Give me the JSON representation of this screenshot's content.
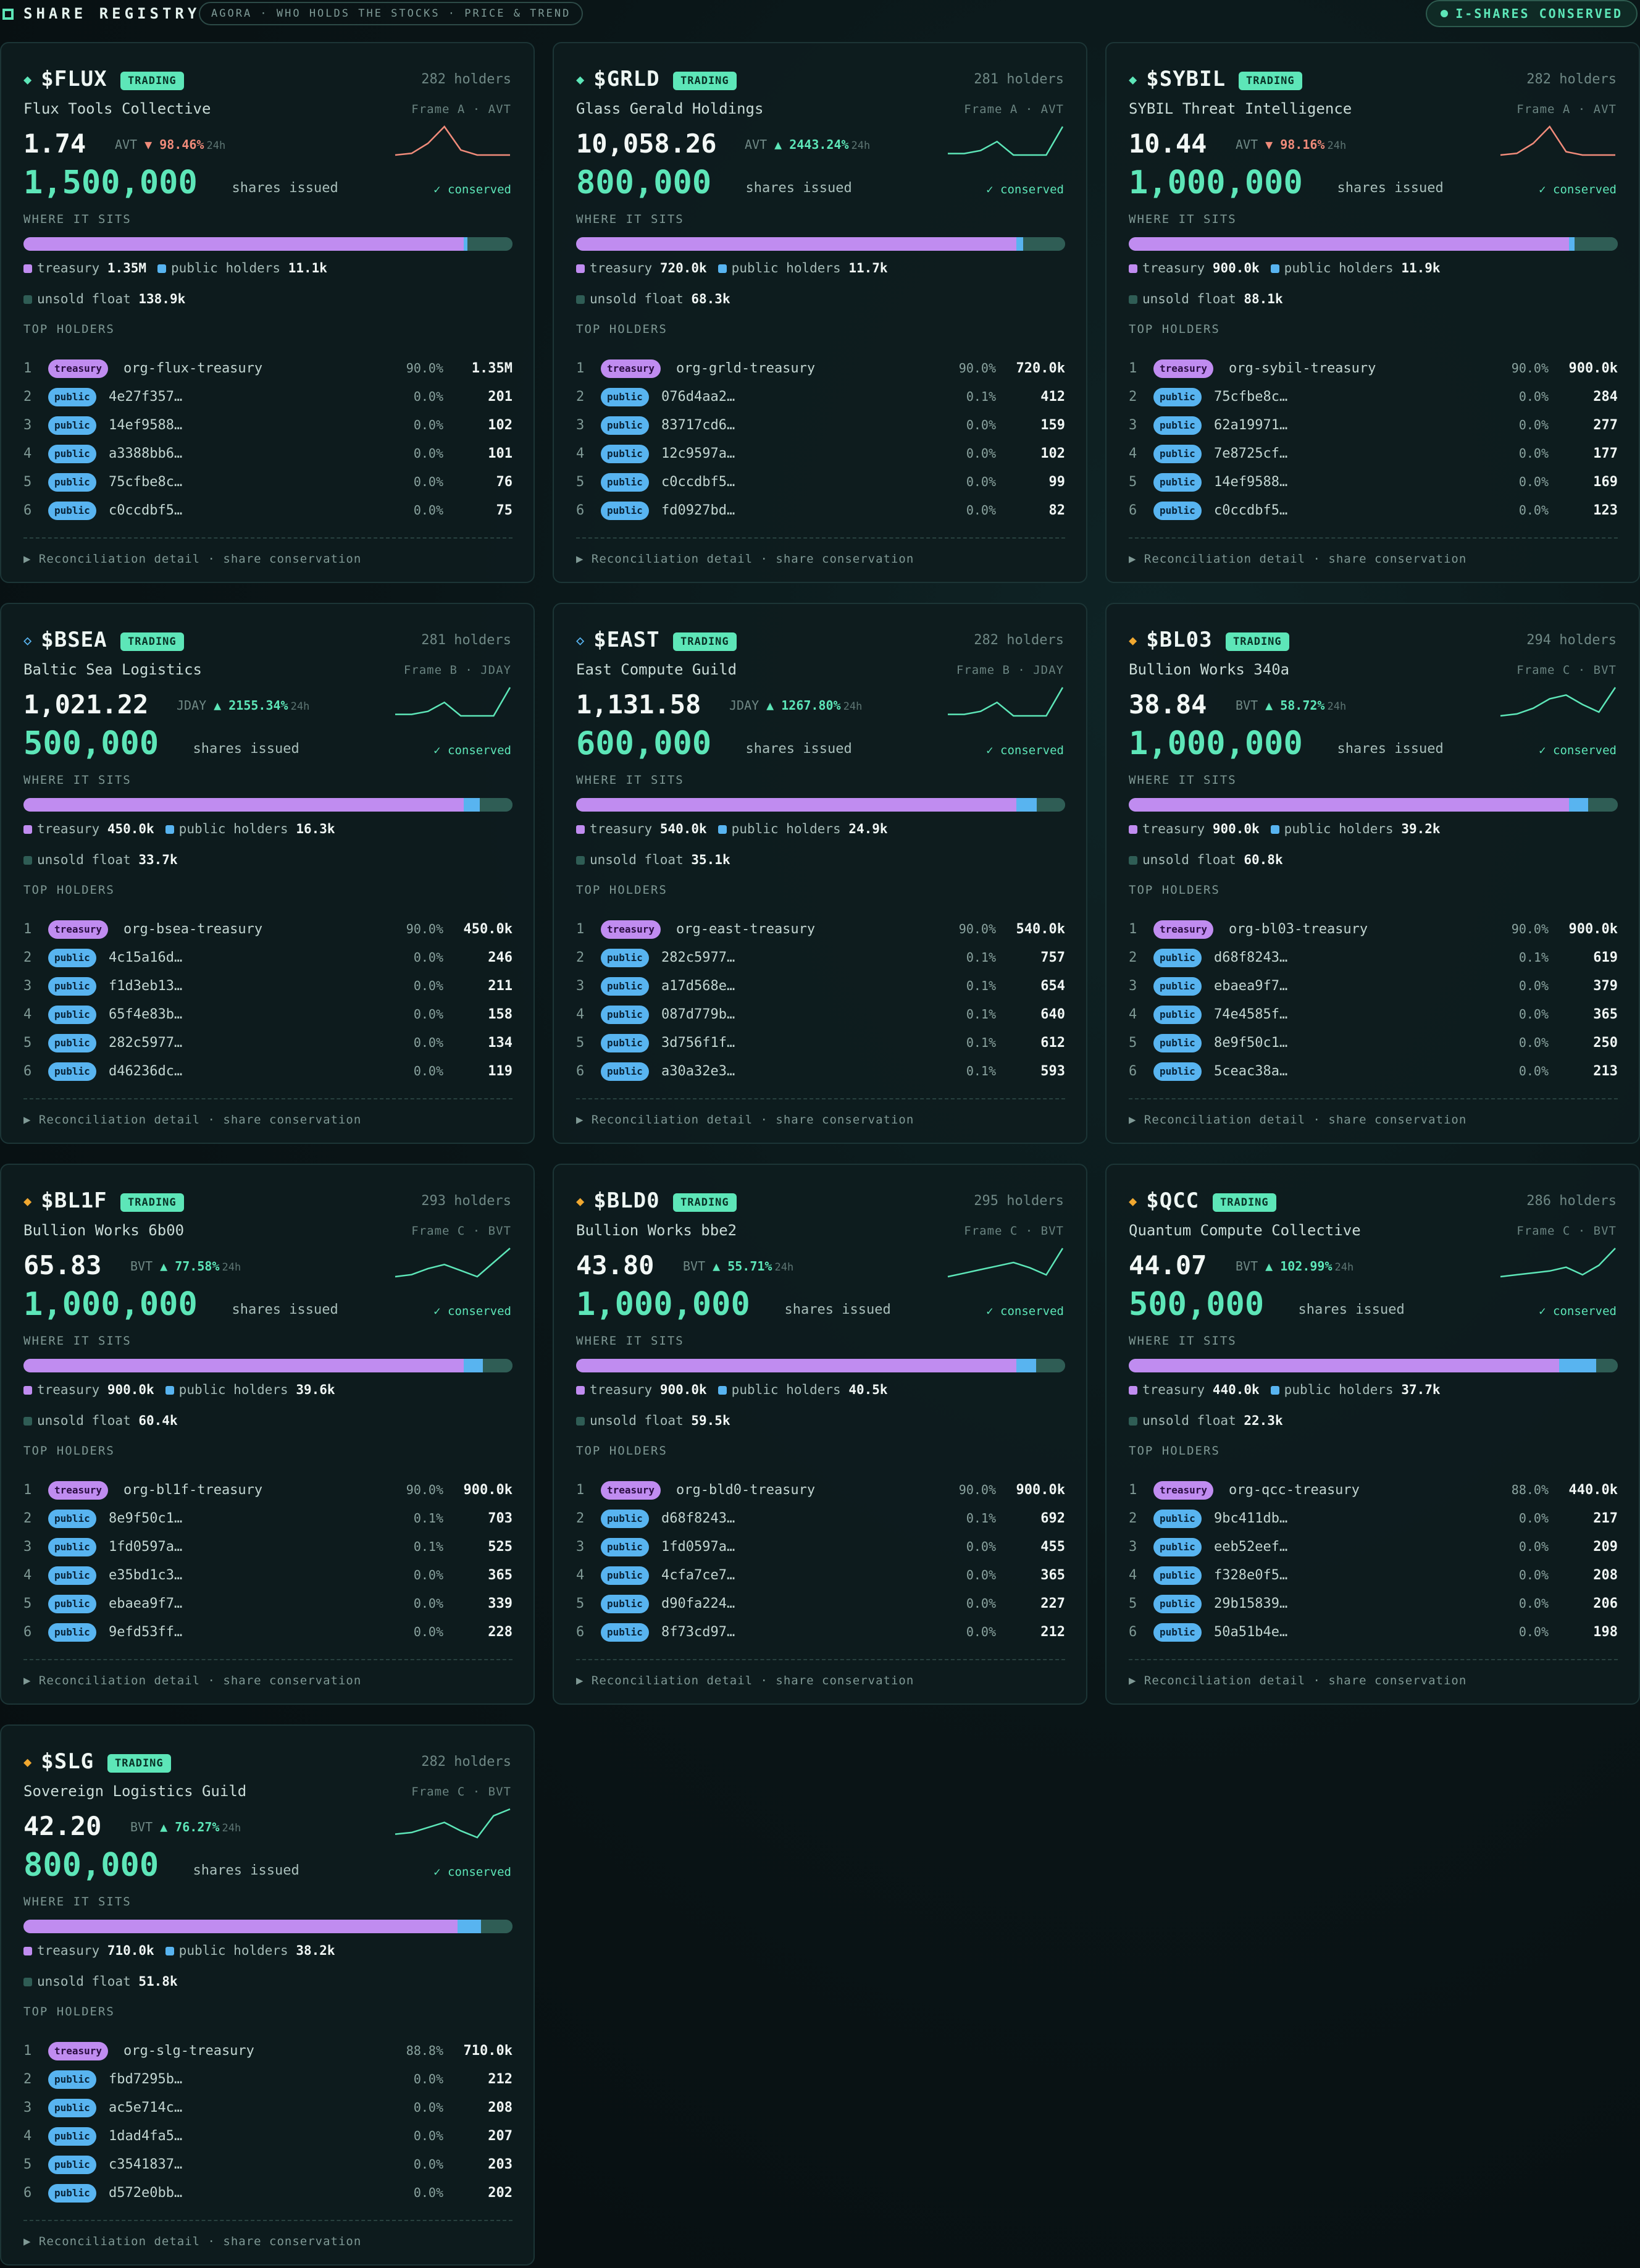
{
  "app": {
    "title": "SHARE REGISTRY",
    "subtitle": "AGORA · WHO HOLDS THE STOCKS · PRICE & TREND",
    "status": "I-SHARES CONSERVED"
  },
  "labels": {
    "trading": "TRADING",
    "shares_issued": "shares issued",
    "conserved": "✓ conserved",
    "where_it_sits": "WHERE IT SITS",
    "treasury": "treasury",
    "public_holders": "public holders",
    "unsold_float": "unsold float",
    "top_holders": "TOP HOLDERS",
    "reconciliation": "▶ Reconciliation detail · share conservation",
    "h24": "24h"
  },
  "colors": {
    "accent": "#5de6b8",
    "treasury": "#c08cf0",
    "public": "#58b4f0",
    "float": "#2f5d55",
    "down": "#f08b7a",
    "frameA": "#5de6b8",
    "frameB": "#58b4f0",
    "frameC": "#f0a830"
  },
  "cards": [
    {
      "ticker": "$FLUX",
      "icon": "diamond-icon",
      "icon_color": "#5de6b8",
      "holders": "282 holders",
      "company": "Flux Tools Collective",
      "frame": "Frame A · AVT",
      "price": "1.74",
      "unit": "AVT",
      "arrow": "▼",
      "change": "98.46%",
      "direction": "down",
      "spark": [
        5,
        6,
        12,
        22,
        8,
        5,
        5,
        5
      ],
      "issued": "1,500,000",
      "treasury_frac": 0.9,
      "public_frac": 0.0074,
      "float_frac": 0.0926,
      "treasury": "1.35M",
      "public": "11.1k",
      "float": "138.9k",
      "top": [
        {
          "n": "1",
          "type": "treasury",
          "name": "org-flux-treasury",
          "pct": "90.0%",
          "amt": "1.35M"
        },
        {
          "n": "2",
          "type": "public",
          "name": "4e27f357…",
          "pct": "0.0%",
          "amt": "201"
        },
        {
          "n": "3",
          "type": "public",
          "name": "14ef9588…",
          "pct": "0.0%",
          "amt": "102"
        },
        {
          "n": "4",
          "type": "public",
          "name": "a3388bb6…",
          "pct": "0.0%",
          "amt": "101"
        },
        {
          "n": "5",
          "type": "public",
          "name": "75cfbe8c…",
          "pct": "0.0%",
          "amt": "76"
        },
        {
          "n": "6",
          "type": "public",
          "name": "c0ccdbf5…",
          "pct": "0.0%",
          "amt": "75"
        }
      ]
    },
    {
      "ticker": "$GRLD",
      "icon": "diamond-icon",
      "icon_color": "#5de6b8",
      "holders": "281 holders",
      "company": "Glass Gerald Holdings",
      "frame": "Frame A · AVT",
      "price": "10,058.26",
      "unit": "AVT",
      "arrow": "▲",
      "change": "2443.24%",
      "direction": "up",
      "spark": [
        4,
        4,
        6,
        12,
        3,
        3,
        3,
        22
      ],
      "issued": "800,000",
      "treasury_frac": 0.9,
      "public_frac": 0.0146,
      "float_frac": 0.0854,
      "treasury": "720.0k",
      "public": "11.7k",
      "float": "68.3k",
      "top": [
        {
          "n": "1",
          "type": "treasury",
          "name": "org-grld-treasury",
          "pct": "90.0%",
          "amt": "720.0k"
        },
        {
          "n": "2",
          "type": "public",
          "name": "076d4aa2…",
          "pct": "0.1%",
          "amt": "412"
        },
        {
          "n": "3",
          "type": "public",
          "name": "83717cd6…",
          "pct": "0.0%",
          "amt": "159"
        },
        {
          "n": "4",
          "type": "public",
          "name": "12c9597a…",
          "pct": "0.0%",
          "amt": "102"
        },
        {
          "n": "5",
          "type": "public",
          "name": "c0ccdbf5…",
          "pct": "0.0%",
          "amt": "99"
        },
        {
          "n": "6",
          "type": "public",
          "name": "fd0927bd…",
          "pct": "0.0%",
          "amt": "82"
        }
      ]
    },
    {
      "ticker": "$SYBIL",
      "icon": "diamond-icon",
      "icon_color": "#5de6b8",
      "holders": "282 holders",
      "company": "SYBIL Threat Intelligence",
      "frame": "Frame A · AVT",
      "price": "10.44",
      "unit": "AVT",
      "arrow": "▼",
      "change": "98.16%",
      "direction": "down",
      "spark": [
        5,
        6,
        12,
        22,
        7,
        5,
        5,
        5
      ],
      "issued": "1,000,000",
      "treasury_frac": 0.9,
      "public_frac": 0.0119,
      "float_frac": 0.0881,
      "treasury": "900.0k",
      "public": "11.9k",
      "float": "88.1k",
      "top": [
        {
          "n": "1",
          "type": "treasury",
          "name": "org-sybil-treasury",
          "pct": "90.0%",
          "amt": "900.0k"
        },
        {
          "n": "2",
          "type": "public",
          "name": "75cfbe8c…",
          "pct": "0.0%",
          "amt": "284"
        },
        {
          "n": "3",
          "type": "public",
          "name": "62a19971…",
          "pct": "0.0%",
          "amt": "277"
        },
        {
          "n": "4",
          "type": "public",
          "name": "7e8725cf…",
          "pct": "0.0%",
          "amt": "177"
        },
        {
          "n": "5",
          "type": "public",
          "name": "14ef9588…",
          "pct": "0.0%",
          "amt": "169"
        },
        {
          "n": "6",
          "type": "public",
          "name": "c0ccdbf5…",
          "pct": "0.0%",
          "amt": "123"
        }
      ]
    },
    {
      "ticker": "$BSEA",
      "icon": "diamond-outline-icon",
      "icon_color": "#58b4f0",
      "holders": "281 holders",
      "company": "Baltic Sea Logistics",
      "frame": "Frame B · JDAY",
      "price": "1,021.22",
      "unit": "JDAY",
      "arrow": "▲",
      "change": "2155.34%",
      "direction": "up",
      "spark": [
        4,
        4,
        6,
        12,
        3,
        3,
        3,
        22
      ],
      "issued": "500,000",
      "treasury_frac": 0.9,
      "public_frac": 0.0326,
      "float_frac": 0.0674,
      "treasury": "450.0k",
      "public": "16.3k",
      "float": "33.7k",
      "top": [
        {
          "n": "1",
          "type": "treasury",
          "name": "org-bsea-treasury",
          "pct": "90.0%",
          "amt": "450.0k"
        },
        {
          "n": "2",
          "type": "public",
          "name": "4c15a16d…",
          "pct": "0.0%",
          "amt": "246"
        },
        {
          "n": "3",
          "type": "public",
          "name": "f1d3eb13…",
          "pct": "0.0%",
          "amt": "211"
        },
        {
          "n": "4",
          "type": "public",
          "name": "65f4e83b…",
          "pct": "0.0%",
          "amt": "158"
        },
        {
          "n": "5",
          "type": "public",
          "name": "282c5977…",
          "pct": "0.0%",
          "amt": "134"
        },
        {
          "n": "6",
          "type": "public",
          "name": "d46236dc…",
          "pct": "0.0%",
          "amt": "119"
        }
      ]
    },
    {
      "ticker": "$EAST",
      "icon": "diamond-outline-icon",
      "icon_color": "#58b4f0",
      "holders": "282 holders",
      "company": "East Compute Guild",
      "frame": "Frame B · JDAY",
      "price": "1,131.58",
      "unit": "JDAY",
      "arrow": "▲",
      "change": "1267.80%",
      "direction": "up",
      "spark": [
        4,
        4,
        6,
        12,
        3,
        3,
        3,
        22
      ],
      "issued": "600,000",
      "treasury_frac": 0.9,
      "public_frac": 0.0415,
      "float_frac": 0.0585,
      "treasury": "540.0k",
      "public": "24.9k",
      "float": "35.1k",
      "top": [
        {
          "n": "1",
          "type": "treasury",
          "name": "org-east-treasury",
          "pct": "90.0%",
          "amt": "540.0k"
        },
        {
          "n": "2",
          "type": "public",
          "name": "282c5977…",
          "pct": "0.1%",
          "amt": "757"
        },
        {
          "n": "3",
          "type": "public",
          "name": "a17d568e…",
          "pct": "0.1%",
          "amt": "654"
        },
        {
          "n": "4",
          "type": "public",
          "name": "087d779b…",
          "pct": "0.1%",
          "amt": "640"
        },
        {
          "n": "5",
          "type": "public",
          "name": "3d756f1f…",
          "pct": "0.1%",
          "amt": "612"
        },
        {
          "n": "6",
          "type": "public",
          "name": "a30a32e3…",
          "pct": "0.1%",
          "amt": "593"
        }
      ]
    },
    {
      "ticker": "$BL03",
      "icon": "diamond-icon",
      "icon_color": "#f0a830",
      "holders": "294 holders",
      "company": "Bullion Works 340a",
      "frame": "Frame C · BVT",
      "price": "38.84",
      "unit": "BVT",
      "arrow": "▲",
      "change": "58.72%",
      "direction": "up",
      "spark": [
        4,
        5,
        8,
        13,
        15,
        10,
        6,
        19
      ],
      "issued": "1,000,000",
      "treasury_frac": 0.9,
      "public_frac": 0.0392,
      "float_frac": 0.0608,
      "treasury": "900.0k",
      "public": "39.2k",
      "float": "60.8k",
      "top": [
        {
          "n": "1",
          "type": "treasury",
          "name": "org-bl03-treasury",
          "pct": "90.0%",
          "amt": "900.0k"
        },
        {
          "n": "2",
          "type": "public",
          "name": "d68f8243…",
          "pct": "0.1%",
          "amt": "619"
        },
        {
          "n": "3",
          "type": "public",
          "name": "ebaea9f7…",
          "pct": "0.0%",
          "amt": "379"
        },
        {
          "n": "4",
          "type": "public",
          "name": "74e4585f…",
          "pct": "0.0%",
          "amt": "365"
        },
        {
          "n": "5",
          "type": "public",
          "name": "8e9f50c1…",
          "pct": "0.0%",
          "amt": "250"
        },
        {
          "n": "6",
          "type": "public",
          "name": "5ceac38a…",
          "pct": "0.0%",
          "amt": "213"
        }
      ]
    },
    {
      "ticker": "$BL1F",
      "icon": "diamond-icon",
      "icon_color": "#f0a830",
      "holders": "293 holders",
      "company": "Bullion Works 6b00",
      "frame": "Frame C · BVT",
      "price": "65.83",
      "unit": "BVT",
      "arrow": "▲",
      "change": "77.58%",
      "direction": "up",
      "spark": [
        5,
        6,
        9,
        11,
        8,
        5,
        12,
        19
      ],
      "issued": "1,000,000",
      "treasury_frac": 0.9,
      "public_frac": 0.0396,
      "float_frac": 0.0604,
      "treasury": "900.0k",
      "public": "39.6k",
      "float": "60.4k",
      "top": [
        {
          "n": "1",
          "type": "treasury",
          "name": "org-bl1f-treasury",
          "pct": "90.0%",
          "amt": "900.0k"
        },
        {
          "n": "2",
          "type": "public",
          "name": "8e9f50c1…",
          "pct": "0.1%",
          "amt": "703"
        },
        {
          "n": "3",
          "type": "public",
          "name": "1fd0597a…",
          "pct": "0.1%",
          "amt": "525"
        },
        {
          "n": "4",
          "type": "public",
          "name": "e35bd1c3…",
          "pct": "0.0%",
          "amt": "365"
        },
        {
          "n": "5",
          "type": "public",
          "name": "ebaea9f7…",
          "pct": "0.0%",
          "amt": "339"
        },
        {
          "n": "6",
          "type": "public",
          "name": "9efd53ff…",
          "pct": "0.0%",
          "amt": "228"
        }
      ]
    },
    {
      "ticker": "$BLD0",
      "icon": "diamond-icon",
      "icon_color": "#f0a830",
      "holders": "295 holders",
      "company": "Bullion Works bbe2",
      "frame": "Frame C · BVT",
      "price": "43.80",
      "unit": "BVT",
      "arrow": "▲",
      "change": "55.71%",
      "direction": "up",
      "spark": [
        4,
        6,
        8,
        10,
        12,
        9,
        5,
        20
      ],
      "issued": "1,000,000",
      "treasury_frac": 0.9,
      "public_frac": 0.0405,
      "float_frac": 0.0595,
      "treasury": "900.0k",
      "public": "40.5k",
      "float": "59.5k",
      "top": [
        {
          "n": "1",
          "type": "treasury",
          "name": "org-bld0-treasury",
          "pct": "90.0%",
          "amt": "900.0k"
        },
        {
          "n": "2",
          "type": "public",
          "name": "d68f8243…",
          "pct": "0.1%",
          "amt": "692"
        },
        {
          "n": "3",
          "type": "public",
          "name": "1fd0597a…",
          "pct": "0.0%",
          "amt": "455"
        },
        {
          "n": "4",
          "type": "public",
          "name": "4cfa7ce7…",
          "pct": "0.0%",
          "amt": "365"
        },
        {
          "n": "5",
          "type": "public",
          "name": "d90fa224…",
          "pct": "0.0%",
          "amt": "227"
        },
        {
          "n": "6",
          "type": "public",
          "name": "8f73cd97…",
          "pct": "0.0%",
          "amt": "212"
        }
      ]
    },
    {
      "ticker": "$QCC",
      "icon": "diamond-icon",
      "icon_color": "#f0a830",
      "holders": "286 holders",
      "company": "Quantum Compute Collective",
      "frame": "Frame C · BVT",
      "price": "44.07",
      "unit": "BVT",
      "arrow": "▲",
      "change": "102.99%",
      "direction": "up",
      "spark": [
        4,
        5,
        6,
        7,
        9,
        5,
        10,
        19
      ],
      "issued": "500,000",
      "treasury_frac": 0.88,
      "public_frac": 0.0754,
      "float_frac": 0.0446,
      "treasury": "440.0k",
      "public": "37.7k",
      "float": "22.3k",
      "top": [
        {
          "n": "1",
          "type": "treasury",
          "name": "org-qcc-treasury",
          "pct": "88.0%",
          "amt": "440.0k"
        },
        {
          "n": "2",
          "type": "public",
          "name": "9bc411db…",
          "pct": "0.0%",
          "amt": "217"
        },
        {
          "n": "3",
          "type": "public",
          "name": "eeb52eef…",
          "pct": "0.0%",
          "amt": "209"
        },
        {
          "n": "4",
          "type": "public",
          "name": "f328e0f5…",
          "pct": "0.0%",
          "amt": "208"
        },
        {
          "n": "5",
          "type": "public",
          "name": "29b15839…",
          "pct": "0.0%",
          "amt": "206"
        },
        {
          "n": "6",
          "type": "public",
          "name": "50a51b4e…",
          "pct": "0.0%",
          "amt": "198"
        }
      ]
    },
    {
      "ticker": "$SLG",
      "icon": "diamond-icon",
      "icon_color": "#f0a830",
      "holders": "282 holders",
      "company": "Sovereign Logistics Guild",
      "frame": "Frame C · BVT",
      "price": "42.20",
      "unit": "BVT",
      "arrow": "▲",
      "change": "76.27%",
      "direction": "up",
      "spark": [
        5,
        6,
        9,
        12,
        7,
        3,
        16,
        20
      ],
      "issued": "800,000",
      "treasury_frac": 0.8875,
      "public_frac": 0.0478,
      "float_frac": 0.0647,
      "treasury": "710.0k",
      "public": "38.2k",
      "float": "51.8k",
      "top": [
        {
          "n": "1",
          "type": "treasury",
          "name": "org-slg-treasury",
          "pct": "88.8%",
          "amt": "710.0k"
        },
        {
          "n": "2",
          "type": "public",
          "name": "fbd7295b…",
          "pct": "0.0%",
          "amt": "212"
        },
        {
          "n": "3",
          "type": "public",
          "name": "ac5e714c…",
          "pct": "0.0%",
          "amt": "208"
        },
        {
          "n": "4",
          "type": "public",
          "name": "1dad4fa5…",
          "pct": "0.0%",
          "amt": "207"
        },
        {
          "n": "5",
          "type": "public",
          "name": "c3541837…",
          "pct": "0.0%",
          "amt": "203"
        },
        {
          "n": "6",
          "type": "public",
          "name": "d572e0bb…",
          "pct": "0.0%",
          "amt": "202"
        }
      ]
    }
  ]
}
